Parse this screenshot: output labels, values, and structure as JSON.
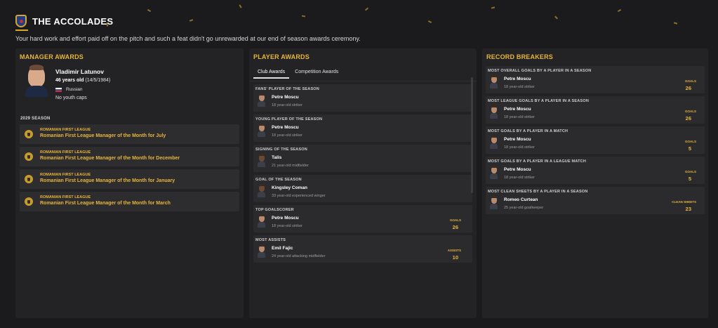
{
  "header": {
    "title": "THE ACCOLADES",
    "subtitle": "Your hard work and effort paid off on the pitch and such a feat didn't go unrewarded at our end of season awards ceremony."
  },
  "manager_awards": {
    "title": "MANAGER AWARDS",
    "name": "Vladimir Latunov",
    "age": "46 years old",
    "dob": "(14/5/1984)",
    "nationality": "Russian",
    "youth_caps": "No youth caps",
    "season": "2029 SEASON",
    "awards": [
      {
        "league": "ROMANIAN FIRST LEAGUE",
        "award": "Romanian First League Manager of the Month for July"
      },
      {
        "league": "ROMANIAN FIRST LEAGUE",
        "award": "Romanian First League Manager of the Month for December"
      },
      {
        "league": "ROMANIAN FIRST LEAGUE",
        "award": "Romanian First League Manager of the Month for January"
      },
      {
        "league": "ROMANIAN FIRST LEAGUE",
        "award": "Romanian First League Manager of the Month for March"
      }
    ]
  },
  "player_awards": {
    "title": "PLAYER AWARDS",
    "tabs": [
      "Club Awards",
      "Competition Awards"
    ],
    "items": [
      {
        "category": "FANS' PLAYER OF THE SEASON",
        "name": "Petre Moscu",
        "desc": "18 year-old striker",
        "stat_label": "",
        "stat_value": ""
      },
      {
        "category": "YOUNG PLAYER OF THE SEASON",
        "name": "Petre Moscu",
        "desc": "18 year-old striker",
        "stat_label": "",
        "stat_value": ""
      },
      {
        "category": "SIGNING OF THE SEASON",
        "name": "Talis",
        "desc": "21 year-old midfielder",
        "stat_label": "",
        "stat_value": ""
      },
      {
        "category": "GOAL OF THE SEASON",
        "name": "Kingsley Coman",
        "desc": "33 year-old experienced winger",
        "stat_label": "",
        "stat_value": ""
      },
      {
        "category": "TOP GOALSCORER",
        "name": "Petre Moscu",
        "desc": "18 year-old striker",
        "stat_label": "GOALS",
        "stat_value": "26"
      },
      {
        "category": "MOST ASSISTS",
        "name": "Emil Fajic",
        "desc": "24 year-old attacking midfielder",
        "stat_label": "ASSISTS",
        "stat_value": "10"
      }
    ]
  },
  "record_breakers": {
    "title": "RECORD BREAKERS",
    "items": [
      {
        "category": "MOST OVERALL GOALS BY A PLAYER IN A SEASON",
        "name": "Petre Moscu",
        "desc": "18 year-old striker",
        "stat_label": "GOALS",
        "stat_value": "26"
      },
      {
        "category": "MOST LEAGUE GOALS BY A PLAYER IN A SEASON",
        "name": "Petre Moscu",
        "desc": "18 year-old striker",
        "stat_label": "GOALS",
        "stat_value": "26"
      },
      {
        "category": "MOST GOALS BY A PLAYER IN A MATCH",
        "name": "Petre Moscu",
        "desc": "18 year-old striker",
        "stat_label": "GOALS",
        "stat_value": "5"
      },
      {
        "category": "MOST GOALS BY A PLAYER IN A LEAGUE MATCH",
        "name": "Petre Moscu",
        "desc": "18 year-old striker",
        "stat_label": "GOALS",
        "stat_value": "5"
      },
      {
        "category": "MOST CLEAN SHEETS BY A PLAYER IN A SEASON",
        "name": "Romeo Curtean",
        "desc": "25 year-old goalkeeper",
        "stat_label": "CLEAN SHEETS",
        "stat_value": "23"
      }
    ]
  },
  "colors": {
    "accent": "#e8b53a",
    "panel": "#232325",
    "background": "#1b1b1d"
  }
}
